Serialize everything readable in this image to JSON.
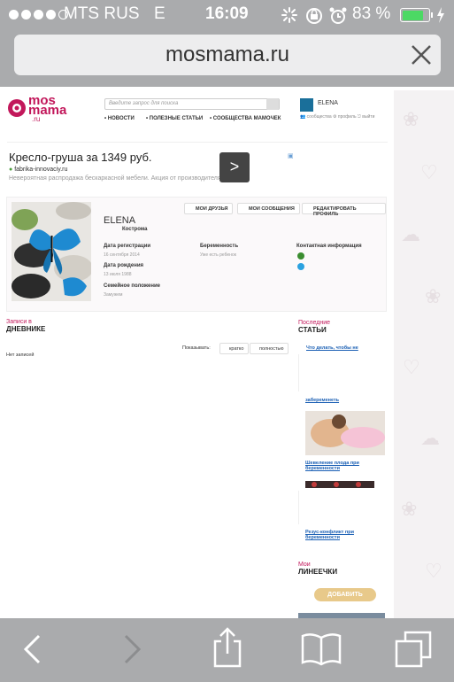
{
  "status": {
    "carrier": "MTS RUS",
    "network": "E",
    "time": "16:09",
    "battery": "83 %"
  },
  "url": "mosmama.ru",
  "site": {
    "logo_mos": "mos",
    "logo_mama": "mama",
    "logo_ru": ".ru",
    "search_placeholder": "Введите запрос для поиска",
    "nav": [
      "• НОВОСТИ",
      "• ПОЛЕЗНЫЕ СТАТЬИ",
      "• СООБЩЕСТВА МАМОЧЕК"
    ],
    "user_name": "ELENA",
    "user_links": "👥 сообщества  ⚙ профиль  ⎋ выйти"
  },
  "ad": {
    "title": "Кресло-груша за 1349 руб.",
    "domain": "fabrika-innovaciy.ru",
    "desc": "Невероятная распродажа бескаркасной мебели. Акция от производителя!",
    "arrow": ">"
  },
  "profile": {
    "btn_friends": "МОИ ДРУЗЬЯ",
    "btn_messages": "МОИ СООБЩЕНИЯ",
    "btn_edit": "РЕДАКТИРОВАТЬ ПРОФИЛЬ",
    "name": "ELENA",
    "city": "Кострома",
    "reg_label": "Дата регистрации",
    "reg_value": "16 сентября 2014",
    "birth_label": "Дата рождения",
    "birth_value": "13 июля 1988",
    "family_label": "Семейное положение",
    "family_value": "Замужем",
    "preg_label": "Беременность",
    "preg_value": "Уже есть ребенок",
    "contact_label": "Контактная информация"
  },
  "diary": {
    "label_a": "Записи в",
    "label_b": "ДНЕВНИКЕ",
    "show": "Показывать:",
    "brief": "кратко",
    "full": "полностью",
    "empty": "Нет записей"
  },
  "articles": {
    "label_a": "Последние",
    "label_b": "СТАТЬИ",
    "items": [
      "Что делать, чтобы не",
      "забеременеть",
      "Шевеление плода при беременности",
      "Резус-конфликт при беременности"
    ]
  },
  "lines": {
    "label_a": "Мои",
    "label_b": "ЛИНЕЕЧКИ",
    "add": "ДОБАВИТЬ ЛИНЕЕЧКУ"
  }
}
